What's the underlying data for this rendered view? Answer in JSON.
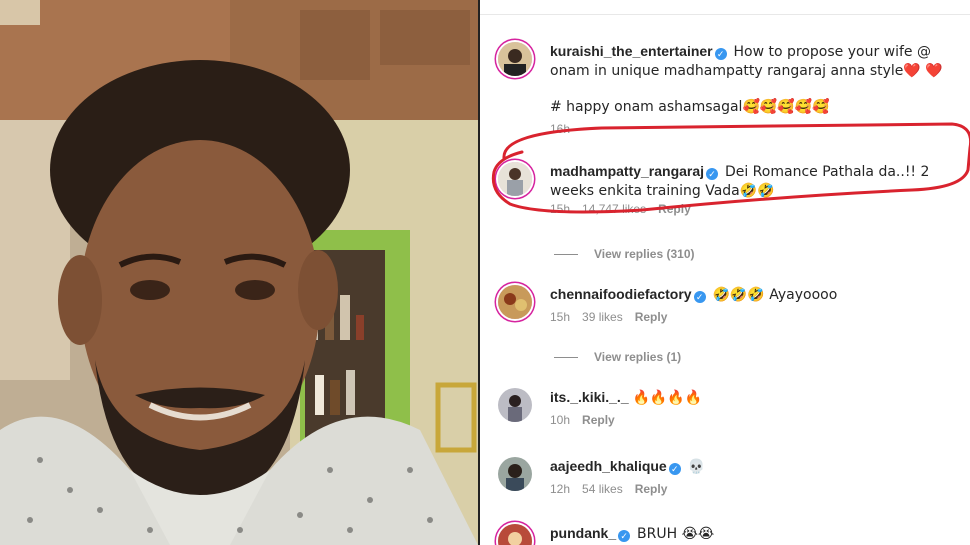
{
  "video": {
    "description": ""
  },
  "comments": [
    {
      "username": "kuraishi_the_entertainer",
      "verified": true,
      "text": "How to propose your wife @ onam in unique madhampatty rangaraj anna style❤️ ❤️",
      "text2": "# happy onam ashamsagal🥰🥰🥰🥰🥰",
      "time": "16h"
    },
    {
      "username": "madhampatty_rangaraj",
      "verified": true,
      "text": "Dei Romance Pathala da..!! 2 weeks enkita training Vada🤣🤣",
      "time": "15h",
      "likes": "14,747 likes",
      "reply": "Reply",
      "view_replies": "View replies (310)"
    },
    {
      "username": "chennaifoodiefactory",
      "verified": true,
      "text": "🤣🤣🤣 Ayayoooo",
      "time": "15h",
      "likes": "39 likes",
      "reply": "Reply",
      "view_replies": "View replies (1)"
    },
    {
      "username": "its._.kiki._._",
      "verified": false,
      "text": "🔥🔥🔥🔥",
      "time": "10h",
      "reply": "Reply"
    },
    {
      "username": "aajeedh_khalique",
      "verified": true,
      "text": "💀",
      "time": "12h",
      "likes": "54 likes",
      "reply": "Reply"
    },
    {
      "username": "pundank_",
      "verified": true,
      "text": "BRUH 😭😭"
    }
  ],
  "colors": {
    "highlight": "#d9232e",
    "verified": "#3897f0",
    "meta": "#8e8e8e"
  }
}
